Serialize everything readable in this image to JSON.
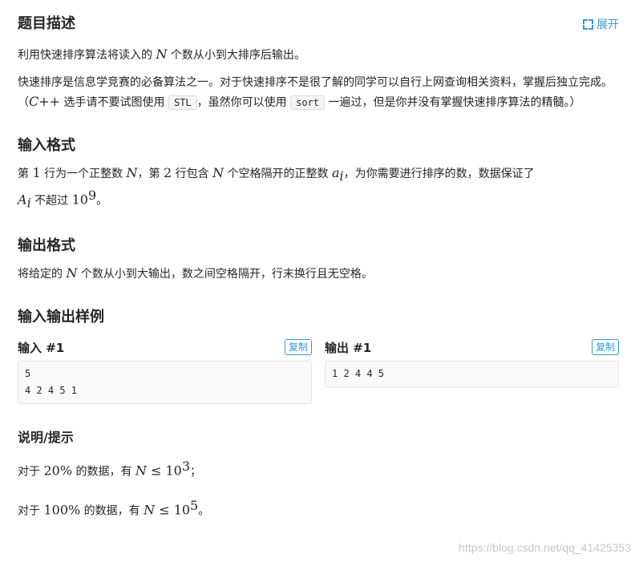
{
  "header": {
    "title": "题目描述",
    "expand_label": "展开"
  },
  "description": {
    "line1_prefix": "利用快速排序算法将读入的 ",
    "line1_var": "N",
    "line1_suffix": " 个数从小到大排序后输出。",
    "p2_part1": "快速排序是信息学竞赛的必备算法之一。对于快速排序不是很了解的同学可以自行上网查询相关资料，掌握后独立完成。（",
    "p2_cpp": "C++",
    "p2_part2": " 选手请不要试图使用 ",
    "p2_code1": "STL",
    "p2_part3": "，虽然你可以使用 ",
    "p2_code2": "sort",
    "p2_part4": " 一遍过，但是你并没有掌握快速排序算法的精髓。）"
  },
  "input_format": {
    "title": "输入格式",
    "t1": "第 ",
    "n1": "1",
    "t2": " 行为一个正整数 ",
    "v1": "N",
    "t3": "，第 ",
    "n2": "2",
    "t4": " 行包含 ",
    "v2": "N",
    "t5": " 个空格隔开的正整数 ",
    "v3": "a",
    "v3_sub": "i",
    "t6": "，为你需要进行排序的数，数据保证了",
    "v4": "A",
    "v4_sub": "i",
    "t7": " 不超过 ",
    "n3": "10",
    "n3_sup": "9",
    "t8": "。"
  },
  "output_format": {
    "title": "输出格式",
    "t1": "将给定的 ",
    "v1": "N",
    "t2": " 个数从小到大输出，数之间空格隔开，行末换行且无空格。"
  },
  "samples": {
    "title": "输入输出样例",
    "input_title": "输入 #1",
    "output_title": "输出 #1",
    "copy_label": "复制",
    "input_text": "5\n4 2 4 5 1",
    "output_text": "1 2 4 4 5"
  },
  "hint": {
    "title": "说明/提示",
    "l1_t1": "对于 ",
    "l1_pct": "20%",
    "l1_t2": " 的数据，有 ",
    "l1_var": "N",
    "l1_rel": " ≤ ",
    "l1_num": "10",
    "l1_sup": "3",
    "l1_end": "；",
    "l2_t1": "对于 ",
    "l2_pct": "100%",
    "l2_t2": " 的数据，有 ",
    "l2_var": "N",
    "l2_rel": " ≤ ",
    "l2_num": "10",
    "l2_sup": "5",
    "l2_end": "。"
  },
  "watermark": "https://blog.csdn.net/qq_41425353",
  "colors": {
    "accent": "#3498db",
    "text": "#262626"
  }
}
